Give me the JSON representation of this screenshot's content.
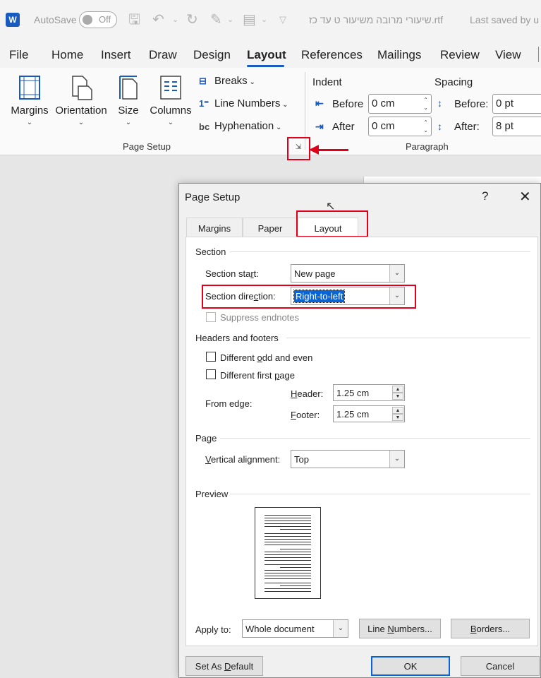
{
  "titlebar": {
    "app_logo": "W",
    "autosave_label": "AutoSave",
    "autosave_state": "Off",
    "doc_title": "שיעורי מרובה משיעור ט עד כז.rtf",
    "save_status": "Last saved by u",
    "icons": [
      "save-icon",
      "undo-icon",
      "redo-icon",
      "format-painter-icon",
      "touch-mode-icon",
      "customize-icon"
    ]
  },
  "tabs": [
    {
      "label": "File"
    },
    {
      "label": "Home"
    },
    {
      "label": "Insert"
    },
    {
      "label": "Draw"
    },
    {
      "label": "Design"
    },
    {
      "label": "Layout",
      "active": true
    },
    {
      "label": "References"
    },
    {
      "label": "Mailings"
    },
    {
      "label": "Review"
    },
    {
      "label": "View"
    }
  ],
  "ribbon": {
    "page_setup": {
      "margins": "Margins",
      "orientation": "Orientation",
      "size": "Size",
      "columns": "Columns",
      "breaks": "Breaks",
      "line_numbers": "Line Numbers",
      "hyphenation": "Hyphenation",
      "group_label": "Page Setup"
    },
    "paragraph": {
      "indent_title": "Indent",
      "spacing_title": "Spacing",
      "before_label": "Before",
      "after_label": "After",
      "before_value": "0 cm",
      "after_value": "0 cm",
      "spacing_before_label": "Before:",
      "spacing_after_label": "After:",
      "spacing_before_value": "0 pt",
      "spacing_after_value": "8 pt",
      "group_label": "Paragraph"
    }
  },
  "dialog": {
    "title": "Page Setup",
    "help": "?",
    "close": "✕",
    "tabs": [
      {
        "label": "Margins"
      },
      {
        "label": "Paper"
      },
      {
        "label": "Layout",
        "active": true
      }
    ],
    "section": {
      "heading": "Section",
      "start_label_pre": "Section sta",
      "start_label_key": "r",
      "start_label_post": "t:",
      "start_value": "New page",
      "direction_label_pre": "Section dire",
      "direction_label_key": "c",
      "direction_label_post": "tion:",
      "direction_value": "Right-to-left",
      "suppress_endnotes": "Suppress endnotes"
    },
    "headers_footers": {
      "heading": "Headers and footers",
      "odd_even_pre": "Different ",
      "odd_even_key": "o",
      "odd_even_post": "dd and even",
      "first_page_pre": "Different first ",
      "first_page_key": "p",
      "first_page_post": "age",
      "from_edge": "From edge:",
      "header_key": "H",
      "header_post": "eader:",
      "header_value": "1.25 cm",
      "footer_key": "F",
      "footer_post": "ooter:",
      "footer_value": "1.25 cm"
    },
    "page": {
      "heading": "Page",
      "valign_key": "V",
      "valign_post": "ertical alignment:",
      "valign_value": "Top"
    },
    "preview": {
      "heading": "Preview"
    },
    "apply_to_pre": "Apply to:",
    "apply_to_value": "Whole document",
    "line_numbers_pre": "Line ",
    "line_numbers_key": "N",
    "line_numbers_post": "umbers...",
    "borders_key": "B",
    "borders_post": "orders...",
    "set_default_pre": "Set As ",
    "set_default_key": "D",
    "set_default_post": "efault",
    "ok": "OK",
    "cancel": "Cancel"
  },
  "colors": {
    "accent": "#185abd",
    "highlight": "#e0001b",
    "selection": "#0a64d6"
  }
}
